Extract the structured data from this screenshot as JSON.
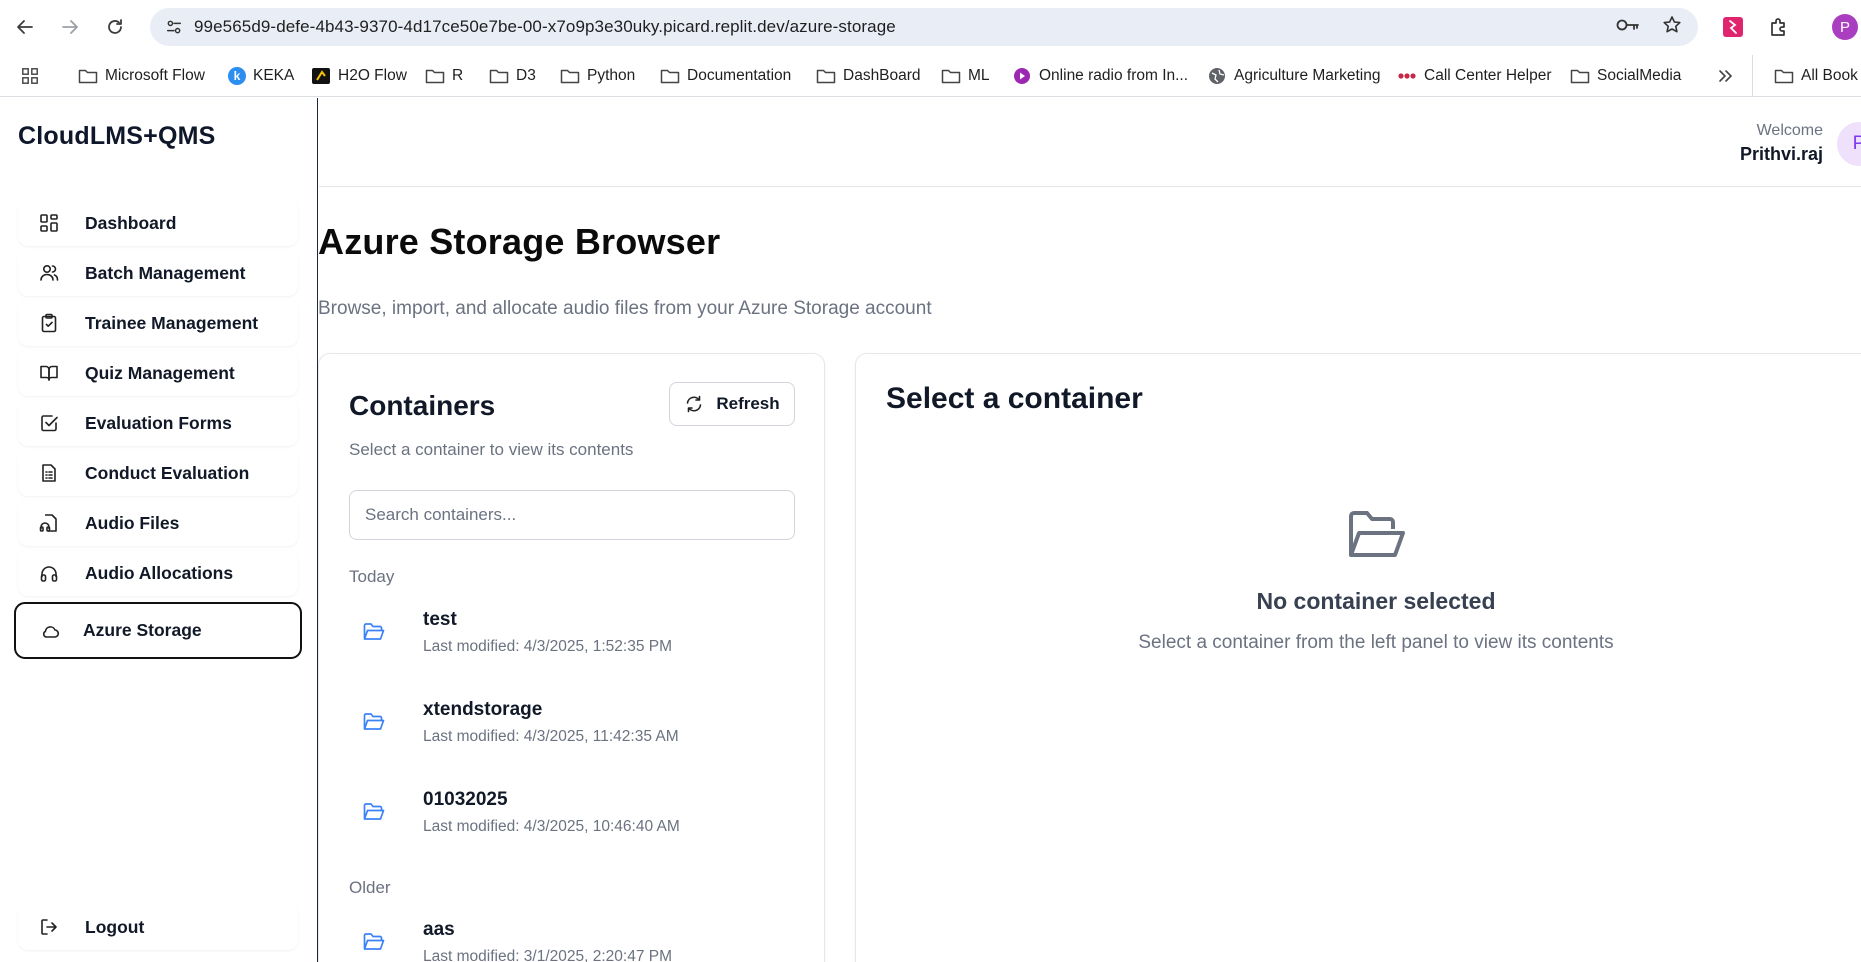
{
  "browser": {
    "url": "99e565d9-defe-4b43-9370-4d17ce50e7be-00-x7o9p3e30uky.picard.replit.dev/azure-storage",
    "profile_initial": "P",
    "bookmarks": [
      {
        "label": "Microsoft Flow",
        "icon": "folder-icon"
      },
      {
        "label": "KEKA",
        "icon": "keka-icon"
      },
      {
        "label": "H2O Flow",
        "icon": "h2o-icon"
      },
      {
        "label": "R",
        "icon": "folder-icon"
      },
      {
        "label": "D3",
        "icon": "folder-icon"
      },
      {
        "label": "Python",
        "icon": "folder-icon"
      },
      {
        "label": "Documentation",
        "icon": "folder-icon"
      },
      {
        "label": "DashBoard",
        "icon": "folder-icon"
      },
      {
        "label": "ML",
        "icon": "folder-icon"
      },
      {
        "label": "Online radio from In...",
        "icon": "radio-icon"
      },
      {
        "label": "Agriculture Marketing",
        "icon": "globe-icon"
      },
      {
        "label": "Call Center Helper",
        "icon": "dots-icon"
      },
      {
        "label": "SocialMedia",
        "icon": "folder-icon"
      },
      {
        "label": "All Book",
        "icon": "folder-icon"
      }
    ]
  },
  "sidebar": {
    "brand": "CloudLMS+QMS",
    "items": [
      {
        "label": "Dashboard",
        "icon": "dashboard-icon"
      },
      {
        "label": "Batch Management",
        "icon": "users-icon"
      },
      {
        "label": "Trainee Management",
        "icon": "clipboard-icon"
      },
      {
        "label": "Quiz Management",
        "icon": "book-icon"
      },
      {
        "label": "Evaluation Forms",
        "icon": "check-square-icon"
      },
      {
        "label": "Conduct Evaluation",
        "icon": "file-list-icon"
      },
      {
        "label": "Audio Files",
        "icon": "file-audio-icon"
      },
      {
        "label": "Audio Allocations",
        "icon": "headphones-icon"
      },
      {
        "label": "Azure Storage",
        "icon": "cloud-icon",
        "active": true
      }
    ],
    "logout": "Logout"
  },
  "header": {
    "welcome": "Welcome",
    "user": "Prithvi.raj",
    "avatar_initial": "P"
  },
  "page": {
    "title": "Azure Storage Browser",
    "subtitle": "Browse, import, and allocate audio files from your Azure Storage account"
  },
  "containers": {
    "title": "Containers",
    "subtitle": "Select a container to view its contents",
    "refresh": "Refresh",
    "search_placeholder": "Search containers...",
    "groups": [
      {
        "label": "Today",
        "items": [
          {
            "name": "test",
            "modified": "Last modified: 4/3/2025, 1:52:35 PM"
          },
          {
            "name": "xtendstorage",
            "modified": "Last modified: 4/3/2025, 11:42:35 AM"
          },
          {
            "name": "01032025",
            "modified": "Last modified: 4/3/2025, 10:46:40 AM"
          }
        ]
      },
      {
        "label": "Older",
        "items": [
          {
            "name": "aas",
            "modified": "Last modified: 3/1/2025, 2:20:47 PM"
          }
        ]
      }
    ]
  },
  "detail": {
    "title": "Select a container",
    "empty_title": "No container selected",
    "empty_sub": "Select a container from the left panel to view its contents"
  },
  "colors": {
    "accent_folder": "#3b82f6",
    "muted": "#6b7280",
    "profile": "#a93fc0"
  }
}
